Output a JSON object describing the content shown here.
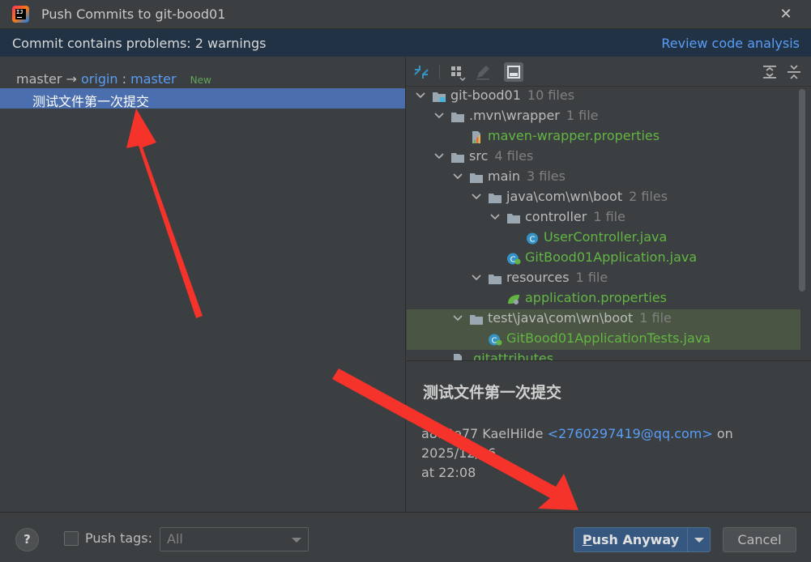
{
  "window": {
    "title": "Push Commits to git-bood01",
    "close_glyph": "✕"
  },
  "warning": {
    "text": "Commit contains problems: 2 warnings",
    "link": "Review code analysis"
  },
  "branch": {
    "local": "master",
    "arrow": "→",
    "remote": "origin",
    "sep": ":",
    "remote_branch": "master",
    "badge": "New"
  },
  "commit": {
    "message": "测试文件第一次提交"
  },
  "toolbar": {
    "icons": [
      "expand-arrows-icon",
      "group-by-icon",
      "edit-icon",
      "preview-diff-icon",
      "expand-all-icon",
      "collapse-all-icon"
    ]
  },
  "tree": [
    {
      "name": "git-bood01",
      "count": "10 files",
      "kind": "module",
      "expanded": true
    },
    {
      "name": ".mvn\\wrapper",
      "count": "1 file",
      "kind": "folder",
      "expanded": true
    },
    {
      "name": "maven-wrapper.properties",
      "count": "",
      "kind": "props-file"
    },
    {
      "name": "src",
      "count": "4 files",
      "kind": "folder",
      "expanded": true
    },
    {
      "name": "main",
      "count": "3 files",
      "kind": "folder",
      "expanded": true
    },
    {
      "name": "java\\com\\wn\\boot",
      "count": "2 files",
      "kind": "folder",
      "expanded": true
    },
    {
      "name": "controller",
      "count": "1 file",
      "kind": "folder",
      "expanded": true
    },
    {
      "name": "UserController.java",
      "count": "",
      "kind": "java-class"
    },
    {
      "name": "GitBood01Application.java",
      "count": "",
      "kind": "spring-class"
    },
    {
      "name": "resources",
      "count": "1 file",
      "kind": "folder",
      "expanded": true
    },
    {
      "name": "application.properties",
      "count": "",
      "kind": "spring-props"
    },
    {
      "name": "test\\java\\com\\wn\\boot",
      "count": "1 file",
      "kind": "folder",
      "expanded": true
    },
    {
      "name": "GitBood01ApplicationTests.java",
      "count": "",
      "kind": "spring-class"
    },
    {
      "name": ".gitattributes",
      "count": "",
      "kind": "text-file"
    }
  ],
  "details": {
    "title": "测试文件第一次提交",
    "hash": "a8a0e77",
    "author": "KaelHilde",
    "email": "<2760297419@qq.com>",
    "on": "on",
    "date": "2025/12/16",
    "at": "at",
    "time": "22:08"
  },
  "footer": {
    "help": "?",
    "push_tags_label": "Push tags:",
    "tags_select_value": "All",
    "push_first_letter": "P",
    "push_rest": "ush Anyway",
    "cancel": "Cancel"
  },
  "colors": {
    "accent": "#4b6eaf",
    "link": "#589df6",
    "annotation_arrow": "#f5332b",
    "modified_file": "#62b543"
  }
}
